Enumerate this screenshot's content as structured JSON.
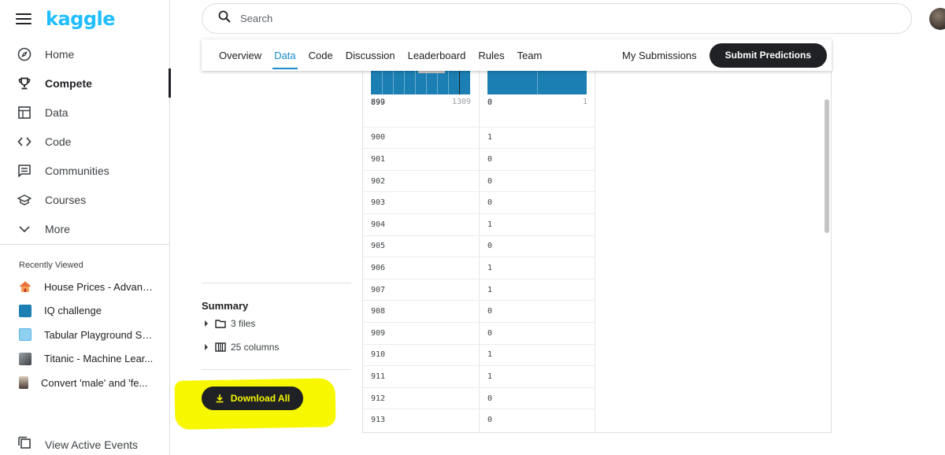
{
  "brand": {
    "name": "kaggle",
    "color": "#20beff"
  },
  "search": {
    "placeholder": "Search"
  },
  "nav": {
    "items": [
      {
        "label": "Home",
        "icon": "compass-icon"
      },
      {
        "label": "Compete",
        "icon": "trophy-icon",
        "active": true
      },
      {
        "label": "Data",
        "icon": "table-icon"
      },
      {
        "label": "Code",
        "icon": "code-icon"
      },
      {
        "label": "Communities",
        "icon": "comment-icon"
      },
      {
        "label": "Courses",
        "icon": "school-icon"
      },
      {
        "label": "More",
        "icon": "chevron-down-icon"
      }
    ]
  },
  "recent": {
    "title": "Recently Viewed",
    "items": [
      {
        "label": "House Prices - Advanc..."
      },
      {
        "label": "IQ challenge"
      },
      {
        "label": "Tabular Playground Se..."
      },
      {
        "label": "Titanic - Machine Lear..."
      },
      {
        "label": "Convert 'male' and 'fe..."
      }
    ]
  },
  "active_events": {
    "label": "View Active Events"
  },
  "tabs": {
    "items": [
      "Overview",
      "Data",
      "Code",
      "Discussion",
      "Leaderboard",
      "Rules",
      "Team"
    ],
    "active": "Data",
    "my_submissions": "My Submissions",
    "submit": "Submit Predictions"
  },
  "summary": {
    "title": "Summary",
    "files": "3 files",
    "columns": "25 columns"
  },
  "download": {
    "label": "Download All",
    "highlight_color": "#f7f700"
  },
  "table": {
    "col1_range": [
      "892",
      "1309"
    ],
    "col2_range": [
      "0",
      "1"
    ],
    "rows": [
      [
        "899",
        "0"
      ],
      [
        "900",
        "1"
      ],
      [
        "901",
        "0"
      ],
      [
        "902",
        "0"
      ],
      [
        "903",
        "0"
      ],
      [
        "904",
        "1"
      ],
      [
        "905",
        "0"
      ],
      [
        "906",
        "1"
      ],
      [
        "907",
        "1"
      ],
      [
        "908",
        "0"
      ],
      [
        "909",
        "0"
      ],
      [
        "910",
        "1"
      ],
      [
        "911",
        "1"
      ],
      [
        "912",
        "0"
      ],
      [
        "913",
        "0"
      ]
    ]
  }
}
